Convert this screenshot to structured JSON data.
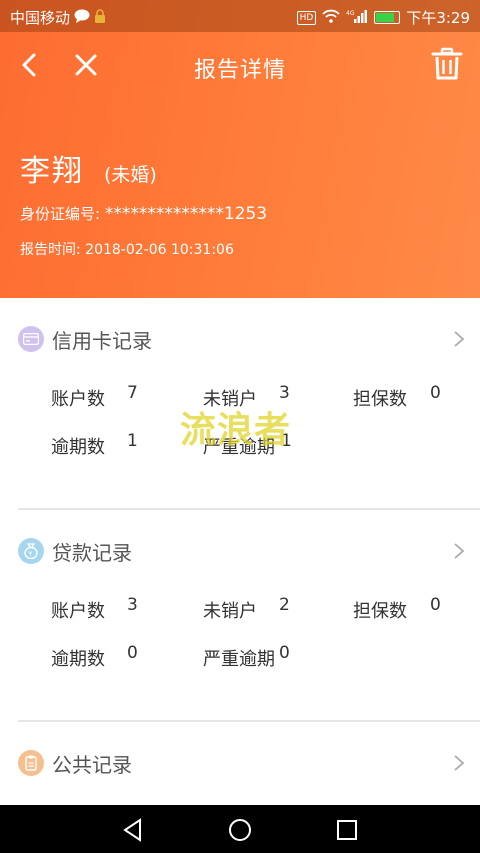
{
  "status_bar": {
    "carrier": "中国移动",
    "hd": "HD",
    "network": "4G",
    "time": "下午3:29"
  },
  "nav": {
    "title": "报告详情"
  },
  "profile": {
    "name": "李翔",
    "marital_status": "(未婚)",
    "id_label": "身份证编号: ",
    "id_value": "**************1253",
    "time_label": "报告时间: ",
    "time_value": "2018-02-06 10:31:06"
  },
  "sections": {
    "credit_card": {
      "title": "信用卡记录",
      "accounts_label": "账户数",
      "accounts_value": "7",
      "unclosed_label": "未销户",
      "unclosed_value": "3",
      "guarantee_label": "担保数",
      "guarantee_value": "0",
      "overdue_label": "逾期数",
      "overdue_value": "1",
      "serious_overdue_label": "严重逾期",
      "serious_overdue_value": "1"
    },
    "loan": {
      "title": "贷款记录",
      "accounts_label": "账户数",
      "accounts_value": "3",
      "unclosed_label": "未销户",
      "unclosed_value": "2",
      "guarantee_label": "担保数",
      "guarantee_value": "0",
      "overdue_label": "逾期数",
      "overdue_value": "0",
      "serious_overdue_label": "严重逾期",
      "serious_overdue_value": "0"
    },
    "public": {
      "title": "公共记录"
    }
  },
  "watermark": "流浪者",
  "colors": {
    "header_start": "#fd6c31",
    "header_end": "#ff8a48",
    "credit_icon": "#b9a6e6",
    "loan_icon": "#8ccbe9",
    "public_icon": "#f3b67a",
    "watermark": "#e1d42a"
  }
}
